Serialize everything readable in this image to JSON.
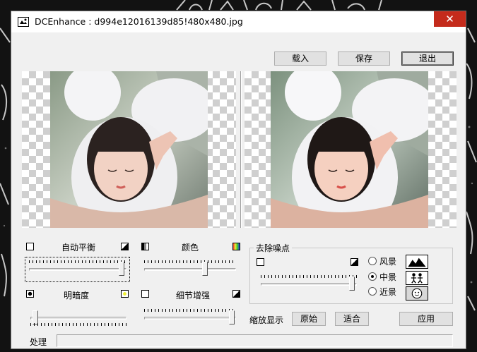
{
  "window": {
    "title": "DCEnhance : d994e12016139d85!480x480.jpg",
    "close_glyph": "✕"
  },
  "buttons": {
    "load": "载入",
    "save": "保存",
    "exit": "退出",
    "original": "原始",
    "fit": "适合",
    "apply": "应用"
  },
  "adjustments": {
    "auto_balance": {
      "label": "自动平衡",
      "value": 0.98
    },
    "color": {
      "label": "颜色",
      "value": 0.67
    },
    "brightness": {
      "label": "明暗度",
      "value": 0.02
    },
    "detail": {
      "label": "细节增强",
      "value": 0.98
    }
  },
  "denoise": {
    "title": "去除噪点",
    "value": 0.98,
    "options": [
      {
        "label": "风景",
        "icon": "mountain-icon",
        "selected": false
      },
      {
        "label": "中景",
        "icon": "people-icon",
        "selected": true
      },
      {
        "label": "近景",
        "icon": "face-icon",
        "selected": false
      }
    ]
  },
  "zoom_label": "缩放显示",
  "status": {
    "label": "处理",
    "value": ""
  },
  "colors": {
    "close": "#c42b1c",
    "panel": "#f0f0f0",
    "titlebar": "#ffffff"
  }
}
